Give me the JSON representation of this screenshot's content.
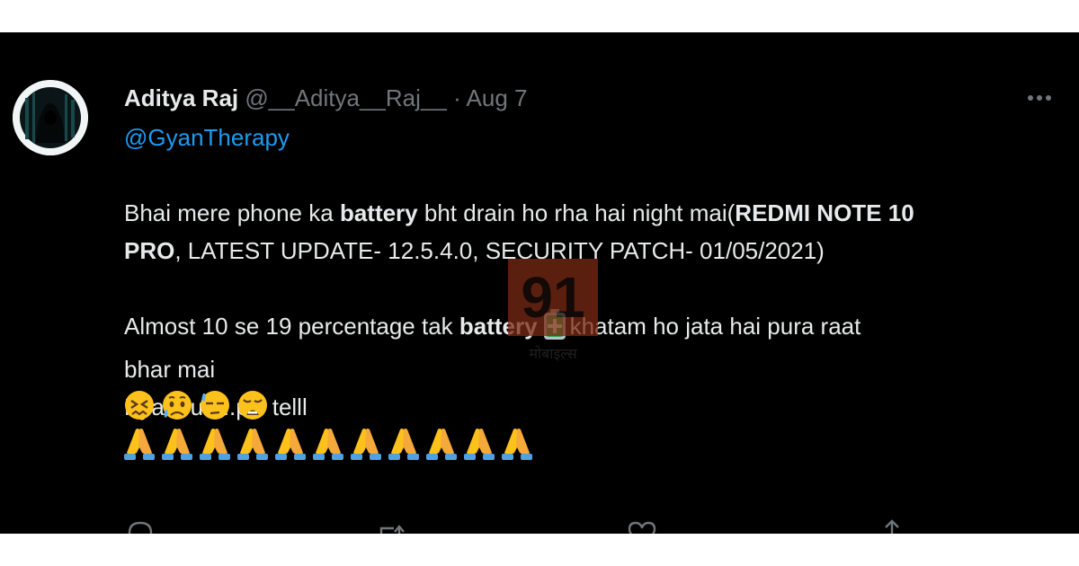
{
  "tweet": {
    "display_name": "Aditya Raj",
    "handle": "@__Aditya__Raj__",
    "separator": "·",
    "date": "Aug 7",
    "reply_to": "@GyanTherapy",
    "line1_a": "Bhai mere phone ka ",
    "line1_b": "battery",
    "line1_c": " bht drain ho rha hai night mai(",
    "line1_d": "REDMI NOTE 10",
    "line2_a": "PRO",
    "line2_b": ", LATEST UPDATE- 12.5.4.0, SECURITY PATCH- 01/05/2021)",
    "line3_a": "Almost 10 se 19 percentage tak ",
    "line3_b": "battery",
    "line3_c": "khatam ho jata hai pura raat",
    "line4": "bhar mai",
    "line5": "Kya kru.....pls telll"
  },
  "watermark": {
    "number": "91",
    "sub": "मोबाइल्स"
  },
  "icons": {
    "more": "more-horizontal-icon",
    "battery_emoji": "battery-emoji",
    "face_emojis": [
      "confounded-face-emoji",
      "disappointed-relieved-face-emoji",
      "downcast-sweat-face-emoji",
      "weary-face-emoji"
    ],
    "pray_emoji": "folded-hands-emoji",
    "actions": [
      "reply-icon",
      "retweet-icon",
      "like-icon",
      "share-icon"
    ]
  },
  "colors": {
    "background": "#000000",
    "text": "#e7e9ea",
    "muted": "#71767b",
    "link": "#1d9bf0",
    "emoji_yellow": "#fcc21b",
    "pray_blue": "#4fa1e0"
  }
}
